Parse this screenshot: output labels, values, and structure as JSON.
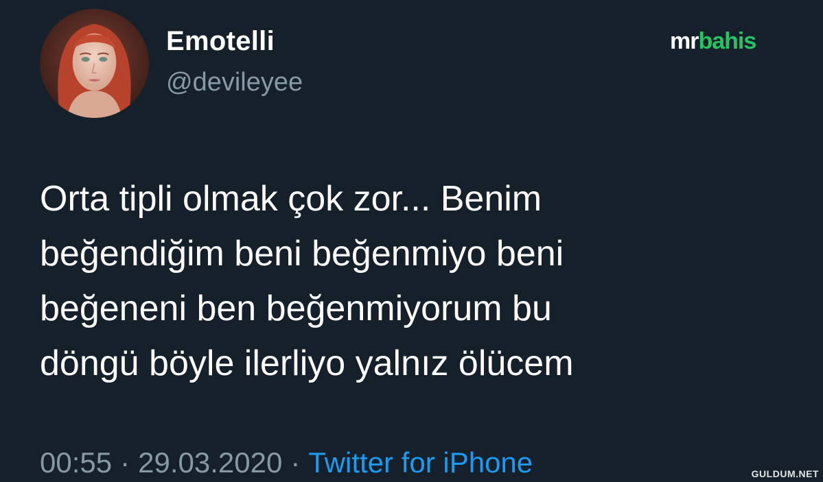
{
  "author": {
    "display_name": "Emotelli",
    "handle": "@devileyee"
  },
  "brand": {
    "part_a": "mr",
    "part_b": "bahis",
    "accent_color": "#27c562"
  },
  "tweet": {
    "lines": [
      "Orta tipli olmak çok zor... Benim",
      "beğendiğim beni beğenmiyo beni",
      "beğeneni ben beğenmiyorum bu",
      "döngü böyle ilerliyo yalnız ölücem"
    ]
  },
  "meta": {
    "time": "00:55",
    "separator": "·",
    "date": "29.03.2020",
    "source": "Twitter for iPhone",
    "source_color": "#1d9bf0"
  },
  "watermark": "GULDUM.NET",
  "colors": {
    "background": "#15202b",
    "secondary_text": "#8899a6"
  }
}
